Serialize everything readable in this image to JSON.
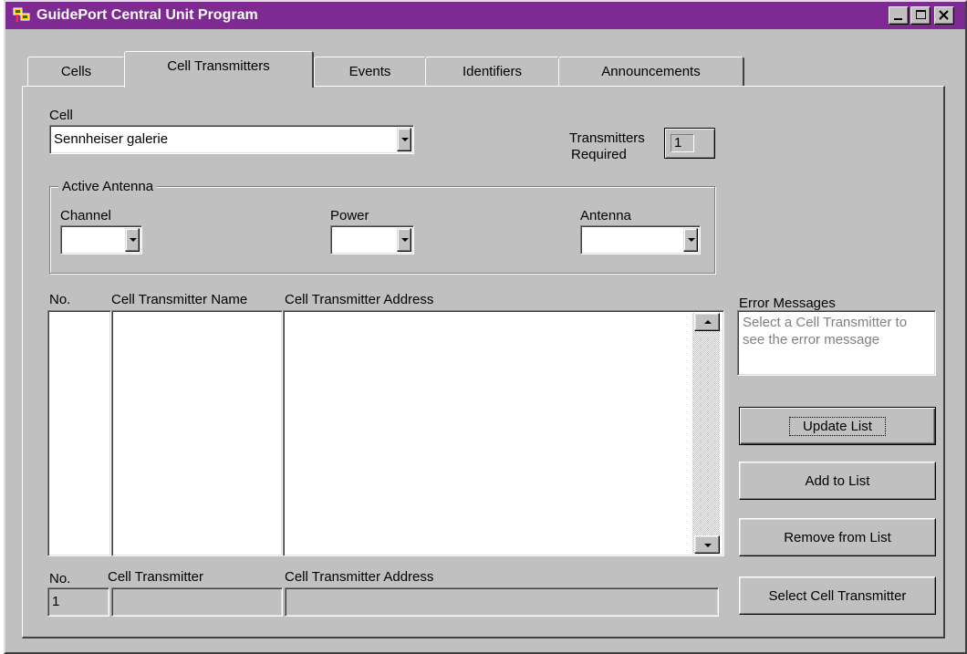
{
  "window": {
    "title": "GuidePort Central Unit Program"
  },
  "tabs": [
    {
      "label": "Cells"
    },
    {
      "label": "Cell Transmitters"
    },
    {
      "label": "Events"
    },
    {
      "label": "Identifiers"
    },
    {
      "label": "Announcements"
    }
  ],
  "active_tab": "Cell Transmitters",
  "cell": {
    "label": "Cell",
    "value": "Sennheiser galerie"
  },
  "transmitters_required": {
    "label_line1": "Transmitters",
    "label_line2": "Required",
    "value": "1"
  },
  "active_antenna": {
    "legend": "Active Antenna",
    "channel_label": "Channel",
    "power_label": "Power",
    "antenna_label": "Antenna"
  },
  "list": {
    "col_no": "No.",
    "col_name": "Cell Transmitter Name",
    "col_address": "Cell Transmitter Address"
  },
  "error_messages": {
    "label": "Error Messages",
    "hint": "Select a Cell Transmitter to see the error message"
  },
  "buttons": {
    "update": "Update List",
    "add": "Add to List",
    "remove": "Remove from List",
    "select": "Select Cell Transmitter"
  },
  "edit": {
    "no_label": "No.",
    "transmitter_label": "Cell Transmitter",
    "address_label": "Cell Transmitter Address",
    "no_value": "1",
    "transmitter_value": "",
    "address_value": ""
  }
}
